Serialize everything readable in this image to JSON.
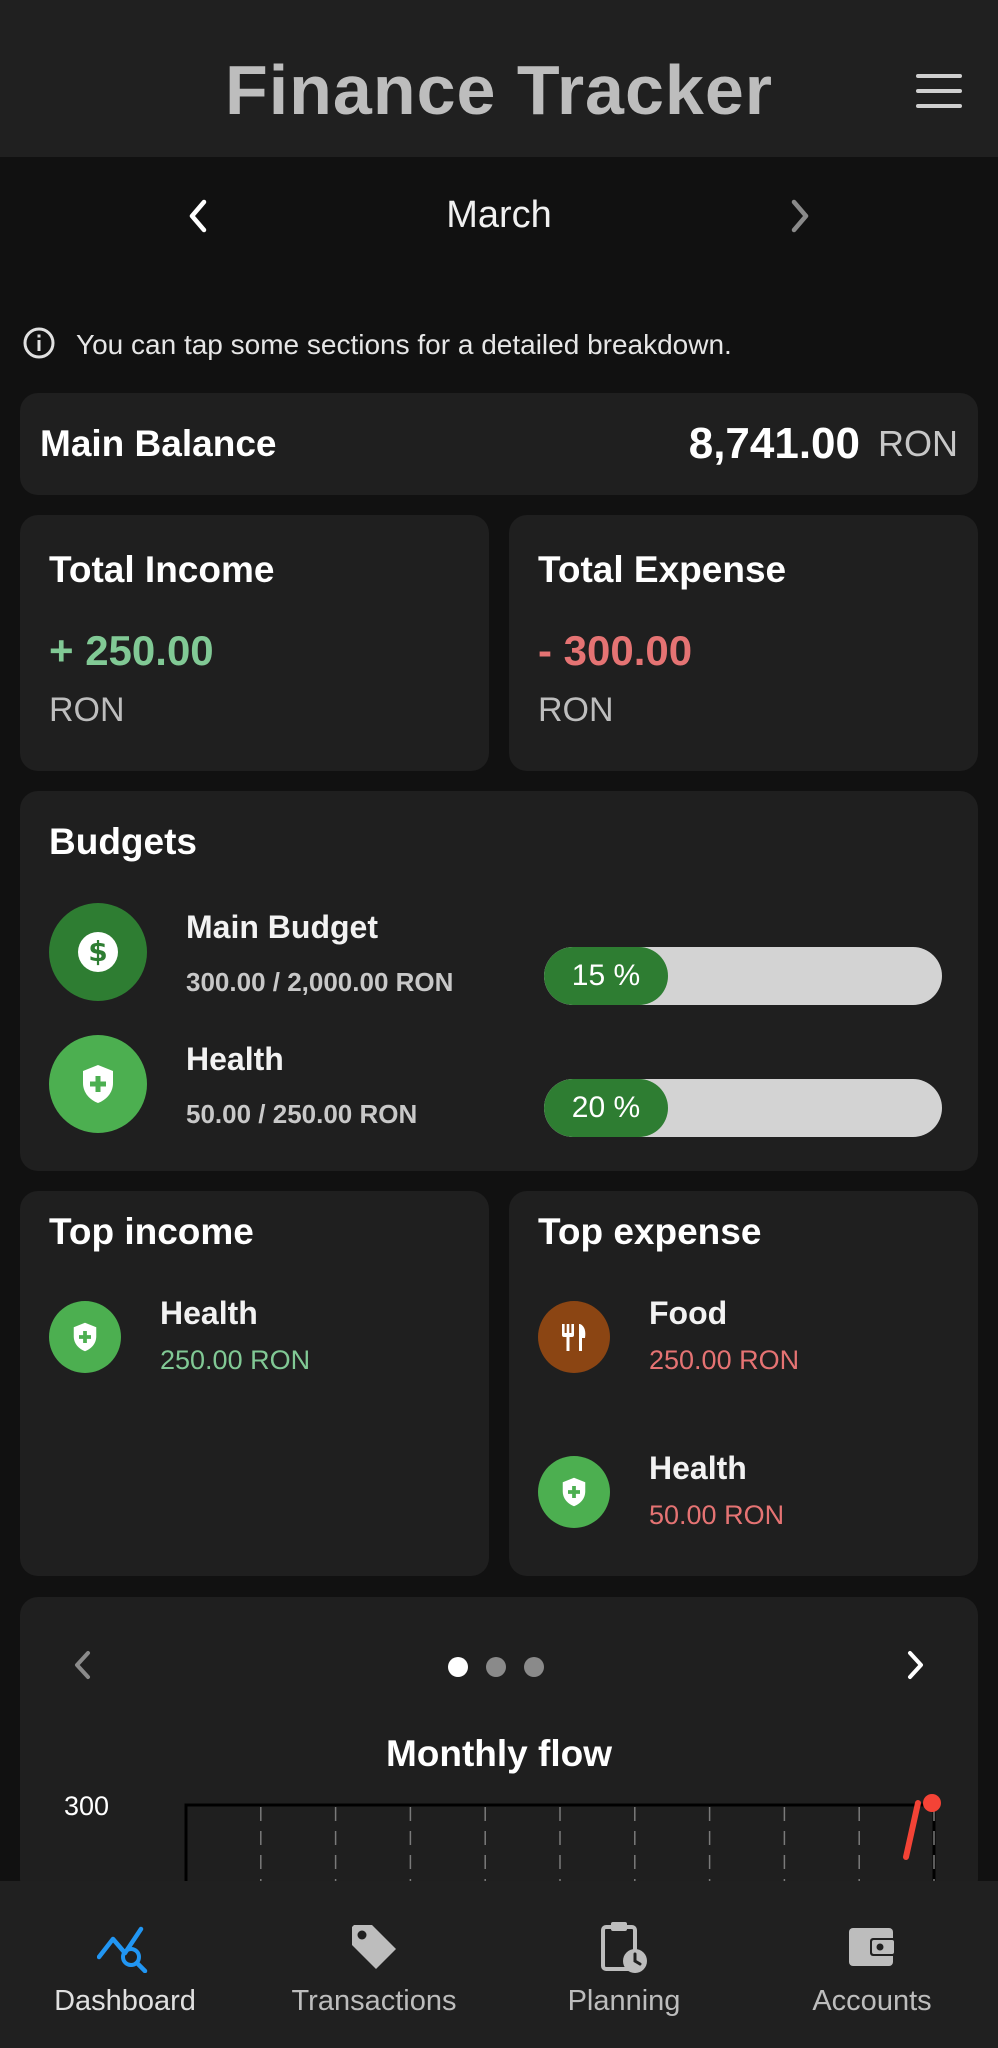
{
  "header": {
    "title": "Finance Tracker",
    "menu_icon": "hamburger-menu-icon"
  },
  "month_nav": {
    "label": "March",
    "prev_icon": "chevron-left-icon",
    "next_icon": "chevron-right-icon"
  },
  "hint": {
    "icon": "info-icon",
    "text": "You can tap some sections for a detailed breakdown."
  },
  "balance": {
    "label": "Main Balance",
    "value": "8,741.00",
    "currency": "RON"
  },
  "income": {
    "title": "Total Income",
    "value": "+ 250.00",
    "currency": "RON",
    "color": "#81c995"
  },
  "expense": {
    "title": "Total Expense",
    "value": "- 300.00",
    "currency": "RON",
    "color": "#e57373"
  },
  "budgets": {
    "title": "Budgets",
    "items": [
      {
        "name": "Main Budget",
        "amount": "300.00 / 2,000.00 RON",
        "percent_label": "15 %",
        "progress": 0.15,
        "icon": "dollar-icon",
        "icon_color": "#2e7d32"
      },
      {
        "name": "Health",
        "amount": "50.00 / 250.00 RON",
        "percent_label": "20 %",
        "progress": 0.2,
        "icon": "shield-plus-icon",
        "icon_color": "#4caf50"
      }
    ]
  },
  "top_income": {
    "title": "Top income",
    "items": [
      {
        "name": "Health",
        "amount": "250.00 RON",
        "icon": "shield-plus-icon",
        "icon_color": "#4caf50"
      }
    ],
    "amount_color": "#81c995"
  },
  "top_expense": {
    "title": "Top expense",
    "items": [
      {
        "name": "Food",
        "amount": "250.00 RON",
        "icon": "fork-knife-icon",
        "icon_color": "#8b4513"
      },
      {
        "name": "Health",
        "amount": "50.00 RON",
        "icon": "shield-plus-icon",
        "icon_color": "#4caf50"
      }
    ],
    "amount_color": "#e57373"
  },
  "carousel": {
    "page_count": 3,
    "active_index": 0
  },
  "chart_data": {
    "type": "line",
    "title": "Monthly flow",
    "y_tick_labels": [
      "300"
    ],
    "series": [
      {
        "color": "#f44336"
      }
    ]
  },
  "bottom_nav": {
    "items": [
      {
        "label": "Dashboard",
        "icon": "chart-search-icon",
        "active": true
      },
      {
        "label": "Transactions",
        "icon": "tag-icon",
        "active": false
      },
      {
        "label": "Planning",
        "icon": "clipboard-clock-icon",
        "active": false
      },
      {
        "label": "Accounts",
        "icon": "wallet-icon",
        "active": false
      }
    ],
    "active_color": "#2196f3"
  }
}
